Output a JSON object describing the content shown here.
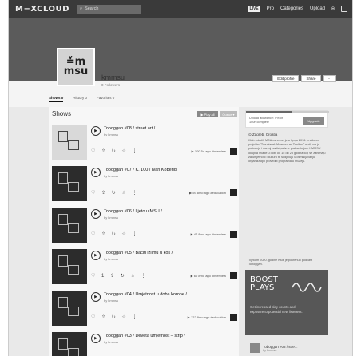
{
  "nav": {
    "logo": "M−XCLOUD",
    "search_placeholder": "Search",
    "live": "LIVE",
    "pro": "Pro",
    "categories": "Categories",
    "upload": "Upload"
  },
  "profile": {
    "avatar_line1": "≚m",
    "avatar_line2": "msu",
    "name": "kmmsu",
    "followers": "0 Followers",
    "edit_profile": "Edit profile",
    "share": "Share",
    "more": "⋯"
  },
  "tabs": [
    "Shows 0",
    "History 0",
    "Favorites 0"
  ],
  "main": {
    "heading": "Shows",
    "play_all": "▶ Play all",
    "queue": "Queue ▾"
  },
  "shows": [
    {
      "title": "Toboggan #08 / street art /",
      "by": "by kmmsu",
      "actions": "♡ ⇪ ↻ ☆ ⋮",
      "meta": "▶ 100  5d ago  #interview",
      "light": true
    },
    {
      "title": "Toboggan #07 / K. 100 / Ivan Koberid",
      "by": "by kmmsu",
      "actions": "♡ ⇪ ↻ ☆ ⋮",
      "meta": "▶ 59  8mo ago  #education",
      "light": false
    },
    {
      "title": "Toboggan #06 / Ljeto u MSU /",
      "by": "by kmmsu",
      "actions": "♡ ⇪ ↻ ☆ ⋮",
      "meta": "▶ 47  8mo ago  #interview",
      "light": false
    },
    {
      "title": "Toboggan #05 / Baciti izlimu u koš /",
      "by": "by kmmsu",
      "actions": "♡ 1 ⇪ ↻ ☆ ⋮",
      "meta": "▶ 60  8mo ago  #interview",
      "light": false
    },
    {
      "title": "Toboggan #04 / Umjetnost u doba korone /",
      "by": "by kmmsu",
      "actions": "♡ ⇪ ↻ ☆ ⋮",
      "meta": "▶ 122  9mo ago  #education",
      "light": false
    },
    {
      "title": "Toboggan #03 / Deveta umjetnost – strip /",
      "by": "by kmmsu",
      "actions": "♡ ⇪ ↻ ☆ ⋮",
      "meta": "",
      "light": false
    }
  ],
  "sidebar": {
    "upgrade_text": "Upload allowance: 0% of 100h complete",
    "upgrade_button": "Upgrade",
    "location": "⊙ Zagreb, Croatia",
    "bio": "Klub mladih MSU osnovan je u lipnju 2016. u sklopu projekta \"Transiscal: Museum as Toolbox\" a cilj mu je poticanje i razvoj participativne prakse kojom KMMSU okuplja mlade u dobi od 15 do 25 godina koji se zanimaju za umjetnost i kulturu te sudjeluju u osmišljavanju, organizaciji i provedbi programa u muzeju.",
    "bio2": "Tijekom 2020. godine Klub je pokrenuo podcast Toboggan.",
    "boost_title_1": "BOOST",
    "boost_title_2": "PLAYS",
    "boost_sub": "Get increased play counts and exposure to potential new listeners.",
    "mini_title": "Toboggan #08 / stre...",
    "mini_by": "by kmmsu"
  }
}
